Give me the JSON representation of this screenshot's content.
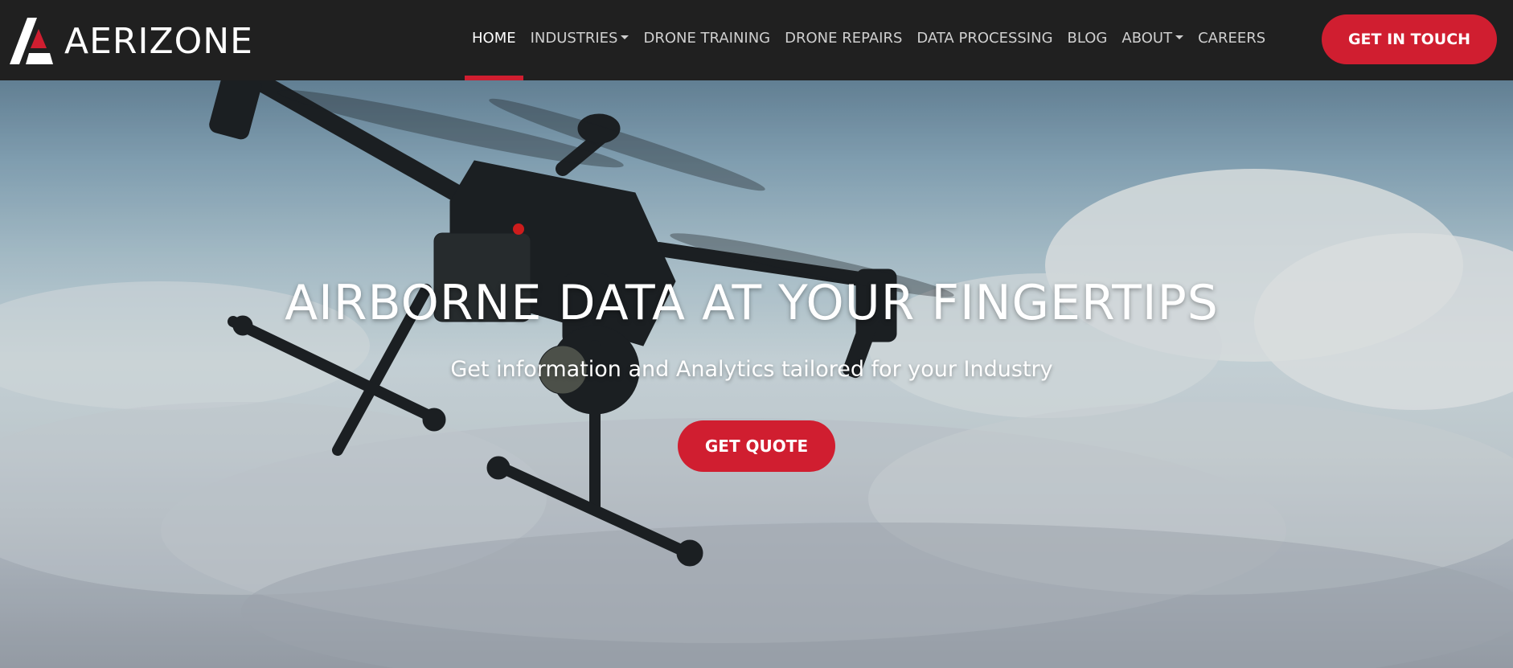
{
  "brand": {
    "name": "AERIZONE",
    "accent_color": "#d01e30",
    "header_bg": "#202020"
  },
  "nav": {
    "items": [
      {
        "label": "HOME",
        "active": true,
        "dropdown": false
      },
      {
        "label": "INDUSTRIES",
        "active": false,
        "dropdown": true
      },
      {
        "label": "DRONE TRAINING",
        "active": false,
        "dropdown": false
      },
      {
        "label": "DRONE REPAIRS",
        "active": false,
        "dropdown": false
      },
      {
        "label": "DATA PROCESSING",
        "active": false,
        "dropdown": false
      },
      {
        "label": "BLOG",
        "active": false,
        "dropdown": false
      },
      {
        "label": "ABOUT",
        "active": false,
        "dropdown": true
      },
      {
        "label": "CAREERS",
        "active": false,
        "dropdown": false
      }
    ],
    "cta_label": "GET IN TOUCH"
  },
  "hero": {
    "title": "AIRBORNE DATA AT YOUR FINGERTIPS",
    "subtitle": "Get information and Analytics tailored for your Industry",
    "cta_label": "GET QUOTE",
    "background": "drone-over-clouds-image"
  }
}
